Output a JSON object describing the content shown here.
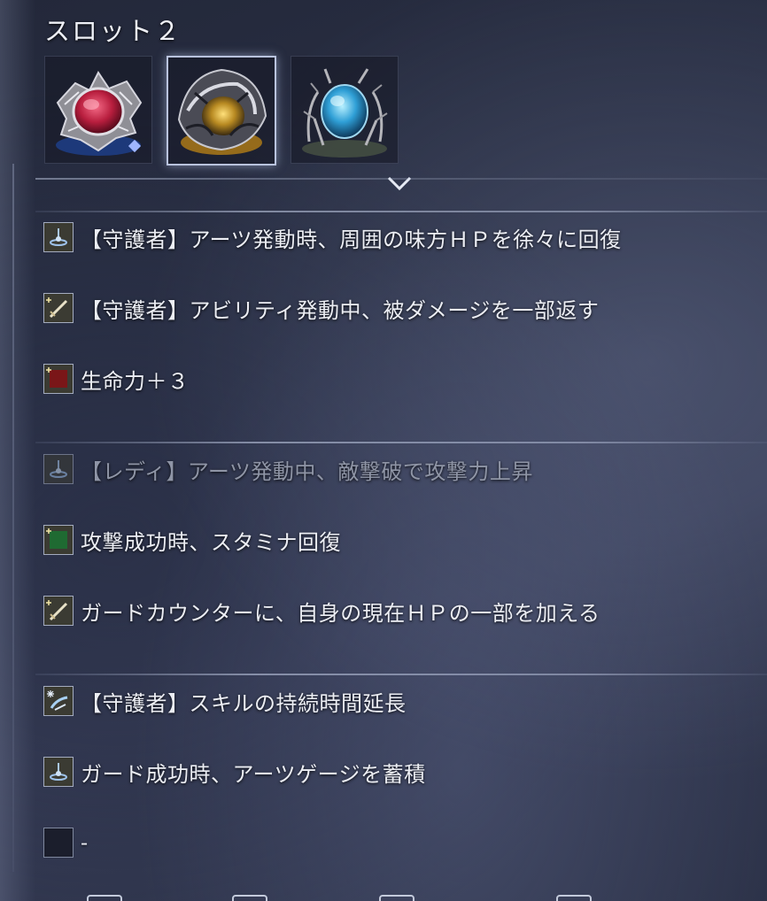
{
  "title": "スロット２",
  "slots": [
    {
      "name": "red-relic",
      "selected": false
    },
    {
      "name": "yellow-relic",
      "selected": true
    },
    {
      "name": "blue-relic",
      "selected": false
    }
  ],
  "effects": [
    {
      "text": "【守護者】アーツ発動時、周囲の味方ＨＰを徐々に回復",
      "icon": "arts-icon",
      "active": true
    },
    {
      "text": "【守護者】アビリティ発動中、被ダメージを一部返す",
      "icon": "sword-icon",
      "active": true
    },
    {
      "text": "生命力＋３",
      "icon": "red-stat-icon",
      "active": true
    },
    {
      "text": "【レディ】アーツ発動中、敵撃破で攻撃力上昇",
      "icon": "arts-icon",
      "active": false
    },
    {
      "text": "攻撃成功時、スタミナ回復",
      "icon": "green-stat-icon",
      "active": true
    },
    {
      "text": "ガードカウンターに、自身の現在ＨＰの一部を加える",
      "icon": "sword-icon",
      "active": true
    },
    {
      "text": "【守護者】スキルの持続時間延長",
      "icon": "skill-icon",
      "active": true
    },
    {
      "text": "ガード成功時、アーツゲージを蓄積",
      "icon": "arts-icon",
      "active": true
    },
    {
      "text": "-",
      "icon": "empty-icon",
      "active": true
    }
  ],
  "colors": {
    "accent": "#b9c3dd",
    "text": "#eceef4",
    "dim_text": "#8f95a6"
  }
}
